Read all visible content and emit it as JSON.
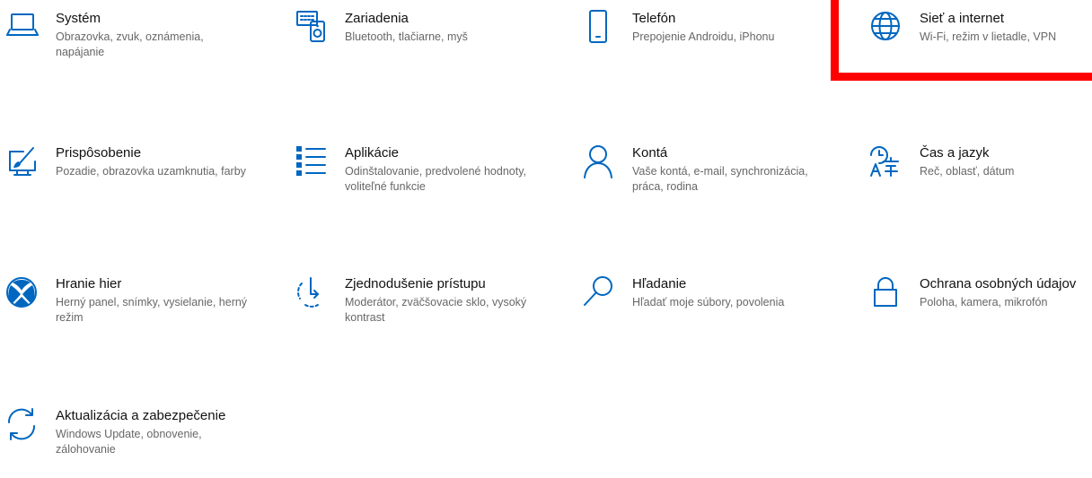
{
  "accent_color": "#0067c0",
  "highlight_color": "#ff0000",
  "tiles": [
    {
      "icon": "laptop-icon",
      "title": "Systém",
      "desc": "Obrazovka, zvuk, oznámenia, napájanie"
    },
    {
      "icon": "devices-icon",
      "title": "Zariadenia",
      "desc": "Bluetooth, tlačiarne, myš"
    },
    {
      "icon": "phone-icon",
      "title": "Telefón",
      "desc": "Prepojenie Androidu, iPhonu"
    },
    {
      "icon": "globe-icon",
      "title": "Sieť a internet",
      "desc": "Wi-Fi, režim v lietadle, VPN"
    },
    {
      "icon": "personalization-icon",
      "title": "Prispôsobenie",
      "desc": "Pozadie, obrazovka uzamknutia, farby"
    },
    {
      "icon": "apps-list-icon",
      "title": "Aplikácie",
      "desc": "Odinštalovanie, predvolené hodnoty, voliteľné funkcie"
    },
    {
      "icon": "person-icon",
      "title": "Kontá",
      "desc": "Vaše kontá, e-mail, synchronizácia, práca, rodina"
    },
    {
      "icon": "time-language-icon",
      "title": "Čas a jazyk",
      "desc": "Reč, oblasť, dátum"
    },
    {
      "icon": "xbox-icon",
      "title": "Hranie hier",
      "desc": "Herný panel, snímky, vysielanie, herný režim"
    },
    {
      "icon": "ease-of-access-icon",
      "title": "Zjednodušenie prístupu",
      "desc": "Moderátor, zväčšovacie sklo, vysoký kontrast"
    },
    {
      "icon": "search-icon",
      "title": "Hľadanie",
      "desc": "Hľadať moje súbory, povolenia"
    },
    {
      "icon": "lock-icon",
      "title": "Ochrana osobných údajov",
      "desc": "Poloha, kamera, mikrofón"
    },
    {
      "icon": "update-sync-icon",
      "title": "Aktualizácia a zabezpečenie",
      "desc": "Windows Update, obnovenie, zálohovanie"
    }
  ]
}
